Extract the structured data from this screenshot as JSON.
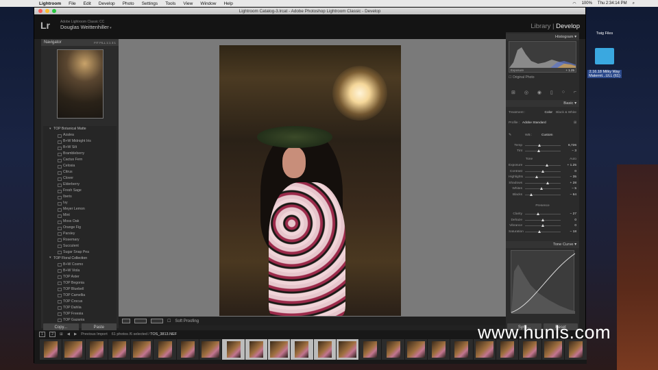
{
  "menubar": {
    "app": "Lightroom",
    "items": [
      "File",
      "Edit",
      "Develop",
      "Photo",
      "Settings",
      "Tools",
      "View",
      "Window",
      "Help"
    ],
    "battery": "100%",
    "clock": "Thu 2:34:14 PM"
  },
  "window": {
    "title": "Lightroom Catalog-3.lrcat - Adobe Photoshop Lightroom Classic - Develop"
  },
  "header": {
    "logo": "Lr",
    "product": "Adobe Lightroom Classic CC",
    "user": "Douglas Weittenhiller",
    "library": "Library",
    "sep": "|",
    "develop": "Develop"
  },
  "navigator": {
    "title": "Navigator",
    "zoom": [
      "FIT",
      "FILL",
      "1:1",
      "3:1"
    ]
  },
  "presets": [
    {
      "label": "TOP Botanical Matte",
      "folder": true
    },
    {
      "label": "Azalea"
    },
    {
      "label": "B+W Midnight Iris"
    },
    {
      "label": "B+W Silt"
    },
    {
      "label": "Brambleberry"
    },
    {
      "label": "Cactus Fern"
    },
    {
      "label": "Celosia"
    },
    {
      "label": "Citrus"
    },
    {
      "label": "Clover"
    },
    {
      "label": "Elderberry"
    },
    {
      "label": "Fresh Sage"
    },
    {
      "label": "Iberis"
    },
    {
      "label": "Ivy"
    },
    {
      "label": "Meyer Lemon"
    },
    {
      "label": "Mint"
    },
    {
      "label": "Moss Oak"
    },
    {
      "label": "Orange Fig"
    },
    {
      "label": "Parsley"
    },
    {
      "label": "Rosemary"
    },
    {
      "label": "Succulent"
    },
    {
      "label": "Sugar Snap Pea"
    },
    {
      "label": "TOP Floral Collection",
      "folder": true
    },
    {
      "label": "B+W Cosmo"
    },
    {
      "label": "B+W Viola"
    },
    {
      "label": "TOP Aster"
    },
    {
      "label": "TOP Begonia"
    },
    {
      "label": "TOP Bluebell"
    },
    {
      "label": "TOP Camellia"
    },
    {
      "label": "TOP Crocus"
    },
    {
      "label": "TOP Dahlia"
    },
    {
      "label": "TOP Freesia"
    },
    {
      "label": "TOP Gazania"
    }
  ],
  "left_buttons": {
    "copy": "Copy...",
    "paste": "Paste"
  },
  "toolbar": {
    "soft_proofing": "Soft Proofing"
  },
  "histogram": {
    "title": "Histogram",
    "exposure_label": "Exposure",
    "exposure_val": "+ 1.25",
    "original": "Original Photo"
  },
  "basic": {
    "title": "Basic",
    "treatment": "Treatment :",
    "color": "Color",
    "bw": "Black & White",
    "profile_label": "Profile :",
    "profile": "Adobe Standard",
    "wb_label": "WB :",
    "wb": "Custom",
    "tone": "Tone",
    "auto": "Auto",
    "presence": "Presence",
    "wb_rows": [
      {
        "label": "Temp",
        "value": "6,726",
        "pos": 0.4
      },
      {
        "label": "Tint",
        "value": "− 3",
        "pos": 0.38
      }
    ],
    "tone_rows": [
      {
        "label": "Exposure",
        "value": "+ 1.25",
        "pos": 0.62
      },
      {
        "label": "Contrast",
        "value": "0",
        "pos": 0.5
      },
      {
        "label": "Highlights",
        "value": "− 35",
        "pos": 0.33
      },
      {
        "label": "Shadows",
        "value": "+ 28",
        "pos": 0.64
      },
      {
        "label": "Whites",
        "value": "− 5",
        "pos": 0.47
      },
      {
        "label": "Blacks",
        "value": "− 64",
        "pos": 0.18
      }
    ],
    "presence_rows": [
      {
        "label": "Clarity",
        "value": "− 27",
        "pos": 0.36
      },
      {
        "label": "Dehaze",
        "value": "0",
        "pos": 0.5
      },
      {
        "label": "Vibrance",
        "value": "0",
        "pos": 0.5
      },
      {
        "label": "Saturation",
        "value": "− 18",
        "pos": 0.41
      }
    ]
  },
  "tone_curve": {
    "title": "Tone Curve"
  },
  "right_buttons": {
    "sync": "Sync...",
    "reset": "Reset"
  },
  "filmstrip": {
    "source": "Previous Import",
    "count": "61 photos /6 selected /",
    "file": "TOS_3813.NEF",
    "selected": [
      8,
      9,
      10,
      11,
      12,
      13
    ]
  },
  "desktop": {
    "folder_label": "Twig Files",
    "file_label": "2.16.18 Milky Way Maternit...ULL (61)"
  },
  "watermark": "www.hunls.com"
}
